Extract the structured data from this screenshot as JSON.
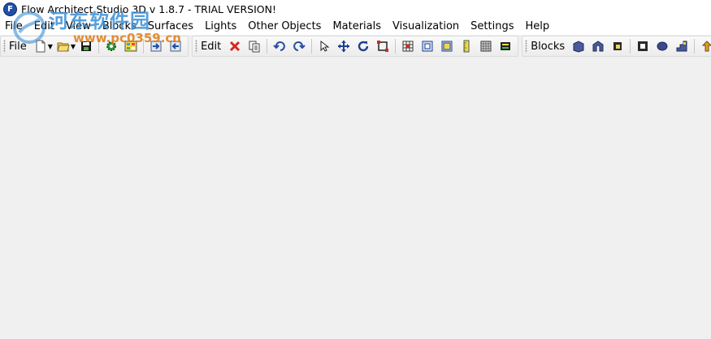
{
  "window": {
    "icon_letter": "F",
    "title": "Flow Architect Studio 3D v 1.8.7  - TRIAL VERSION!"
  },
  "menu": [
    "File",
    "Edit",
    "View",
    "Blocks",
    "Surfaces",
    "Lights",
    "Other Objects",
    "Materials",
    "Visualization",
    "Settings",
    "Help"
  ],
  "toolbars": {
    "file_label": "File",
    "edit_label": "Edit",
    "blocks_label": "Blocks"
  },
  "watermark": {
    "text_cn": "河东软件园",
    "url": "www.pc0359.cn"
  },
  "colors": {
    "accent": "#1f4fa8",
    "background": "#f0f0f0",
    "delete_red": "#d9261c"
  }
}
